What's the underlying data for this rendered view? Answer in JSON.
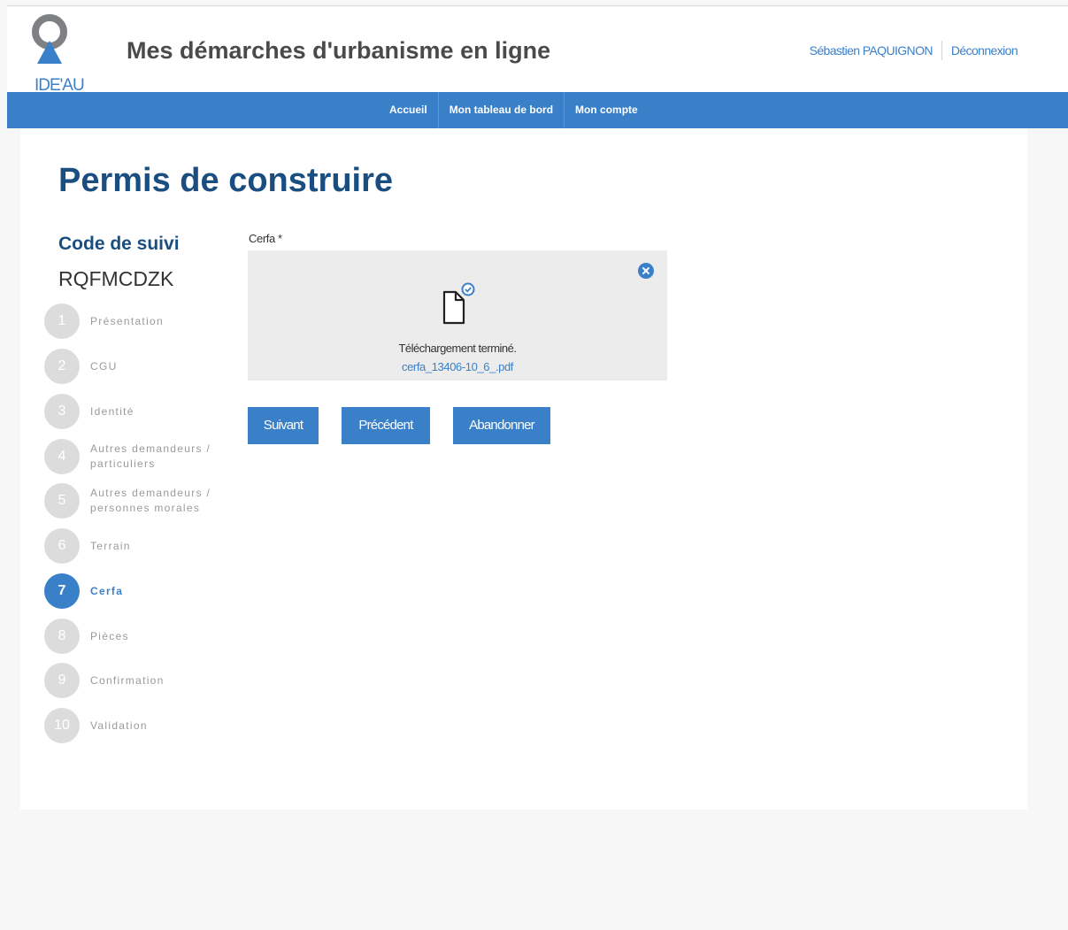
{
  "header": {
    "logo_text": "IDE'AU",
    "site_title": "Mes démarches d'urbanisme en ligne",
    "user_name": "Sébastien PAQUIGNON",
    "logout_label": "Déconnexion"
  },
  "nav": {
    "items": [
      "Accueil",
      "Mon tableau de bord",
      "Mon compte"
    ]
  },
  "page": {
    "title": "Permis de construire",
    "code_label": "Code de suivi",
    "code_value": "RQFMCDZK"
  },
  "steps": [
    {
      "num": "1",
      "label": "Présentation"
    },
    {
      "num": "2",
      "label": "CGU"
    },
    {
      "num": "3",
      "label": "Identité"
    },
    {
      "num": "4",
      "label": "Autres demandeurs / particuliers"
    },
    {
      "num": "5",
      "label": "Autres demandeurs / personnes morales"
    },
    {
      "num": "6",
      "label": "Terrain"
    },
    {
      "num": "7",
      "label": "Cerfa",
      "active": true
    },
    {
      "num": "8",
      "label": "Pièces"
    },
    {
      "num": "9",
      "label": "Confirmation"
    },
    {
      "num": "10",
      "label": "Validation"
    }
  ],
  "form": {
    "cerfa_label": "Cerfa *",
    "upload_status": "Téléchargement terminé.",
    "file_name": "cerfa_13406-10_6_.pdf"
  },
  "buttons": {
    "next": "Suivant",
    "previous": "Précédent",
    "abandon": "Abandonner"
  },
  "colors": {
    "primary": "#3a80c9",
    "title": "#1b4e80",
    "step_inactive": "#dcdcdc",
    "dropzone_bg": "#ececec"
  }
}
